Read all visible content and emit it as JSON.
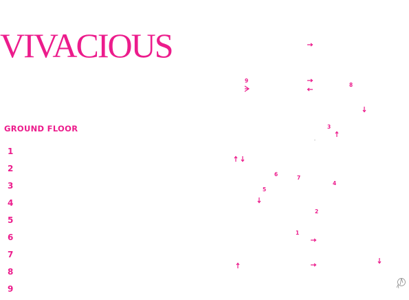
{
  "header": {
    "title": "VIVACIOUS"
  },
  "legend": {
    "floor_label": "GROUND FLOOR",
    "items": [
      "1",
      "2",
      "3",
      "4",
      "5",
      "6",
      "7",
      "8",
      "9"
    ]
  },
  "map": {
    "markers": [
      "9",
      "8",
      "3",
      "6",
      "7",
      "4",
      "5",
      "2",
      "1"
    ],
    "icons": [
      "arrow-right-icon",
      "arrow-left-icon",
      "arrow-up-icon",
      "arrow-down-icon",
      "entrance-icon",
      "compass-icon"
    ]
  },
  "colors": {
    "accent": "#ec1c8c",
    "background": "#ffffff"
  }
}
